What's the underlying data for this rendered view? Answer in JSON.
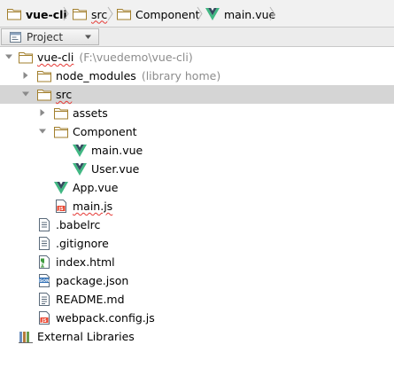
{
  "breadcrumb": {
    "items": [
      {
        "label": "vue-cli",
        "icon": "folder-icon"
      },
      {
        "label": "src",
        "icon": "folder-icon"
      },
      {
        "label": "Component",
        "icon": "folder-icon"
      },
      {
        "label": "main.vue",
        "icon": "vue-file-icon"
      }
    ]
  },
  "panel": {
    "tab_label": "Project"
  },
  "tree": {
    "root": {
      "label": "vue-cli",
      "hint": "(F:\\vuedemo\\vue-cli)"
    },
    "node_modules": {
      "label": "node_modules",
      "hint": "(library home)"
    },
    "src": {
      "label": "src"
    },
    "assets": {
      "label": "assets"
    },
    "component": {
      "label": "Component"
    },
    "main_vue": {
      "label": "main.vue"
    },
    "user_vue": {
      "label": "User.vue"
    },
    "app_vue": {
      "label": "App.vue"
    },
    "main_js": {
      "label": "main.js"
    },
    "babelrc": {
      "label": ".babelrc"
    },
    "gitignore": {
      "label": ".gitignore"
    },
    "index_html": {
      "label": "index.html"
    },
    "package_json": {
      "label": "package.json"
    },
    "readme": {
      "label": "README.md"
    },
    "webpack": {
      "label": "webpack.config.js"
    },
    "external": {
      "label": "External Libraries"
    }
  },
  "colors": {
    "folder": "#c9a34a",
    "vue": "#41b883",
    "vue_dark": "#35495e",
    "selection": "#d5d5d5"
  }
}
